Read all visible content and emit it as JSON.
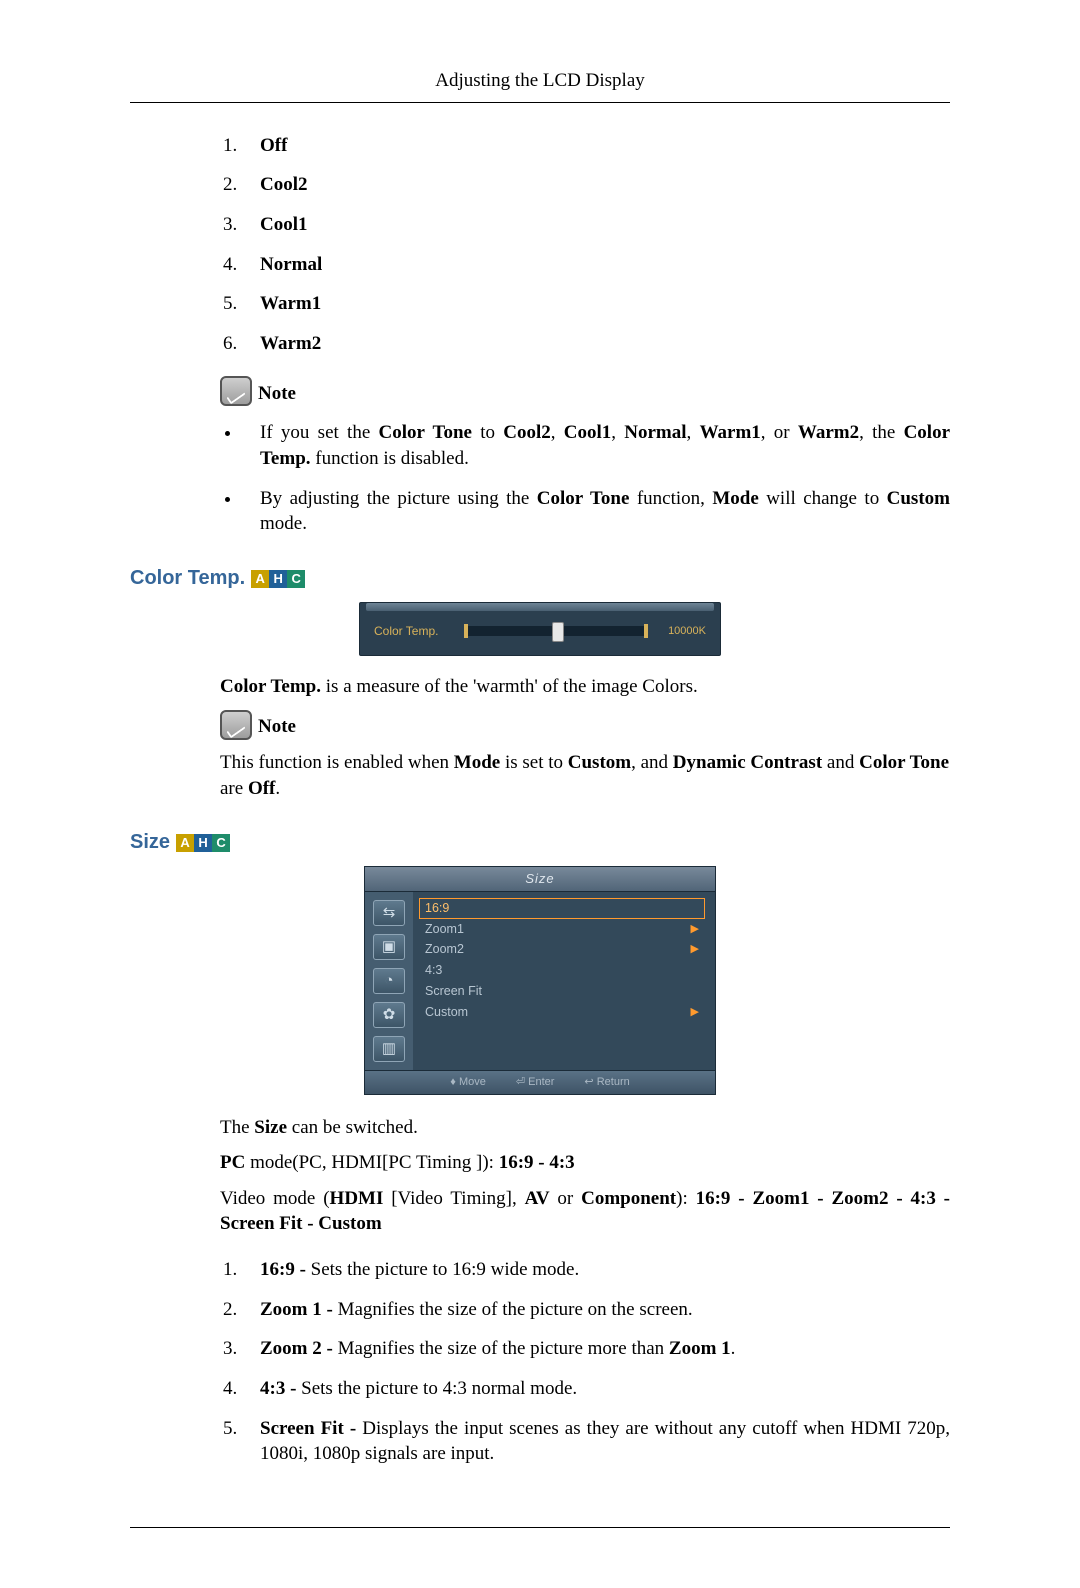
{
  "runningHead": "Adjusting the LCD Display",
  "colorToneOptions": [
    "Off",
    "Cool2",
    "Cool1",
    "Normal",
    "Warm1",
    "Warm2"
  ],
  "noteLabel": "Note",
  "colorToneNotes": {
    "bullet1_pre": "If you set the ",
    "bullet1_b1": "Color Tone",
    "bullet1_mid1": " to ",
    "bullet1_b2": "Cool2",
    "bullet1_c1": ", ",
    "bullet1_b3": "Cool1",
    "bullet1_c2": ", ",
    "bullet1_b4": "Normal",
    "bullet1_c3": ", ",
    "bullet1_b5": "Warm1",
    "bullet1_c4": ", or ",
    "bullet1_b6": "Warm2",
    "bullet1_c5": ", the ",
    "bullet1_b7": "Color Temp.",
    "bullet1_post": " function is disabled.",
    "bullet2_pre": "By adjusting the picture using the ",
    "bullet2_b1": "Color Tone",
    "bullet2_mid": " function, ",
    "bullet2_b2": "Mode",
    "bullet2_mid2": " will change to ",
    "bullet2_b3": "Custom",
    "bullet2_post": " mode."
  },
  "sectionColorTemp": "Color Temp.",
  "badges": {
    "a": "A",
    "h": "H",
    "c": "C"
  },
  "ctPanel": {
    "label": "Color Temp.",
    "value": "10000K"
  },
  "ctDesc": {
    "b1": "Color Temp.",
    "rest": " is a measure of the 'warmth' of the image Colors."
  },
  "ctNote": {
    "pre": "This function is enabled when ",
    "b1": "Mode",
    "mid1": " is set to ",
    "b2": "Custom",
    "mid2": ", and ",
    "b3": "Dynamic Contrast",
    "mid3": " and ",
    "b4": "Color Tone",
    "mid4": " are ",
    "b5": "Off",
    "post": "."
  },
  "sectionSize": "Size",
  "osd": {
    "title": "Size",
    "items": [
      "16:9",
      "Zoom1",
      "Zoom2",
      "4:3",
      "Screen Fit",
      "Custom"
    ],
    "footer": {
      "move": "Move",
      "enter": "Enter",
      "return": "Return"
    }
  },
  "sizeBody1": {
    "pre": "The ",
    "b": "Size",
    "post": " can be switched."
  },
  "sizeBody2": {
    "b1": "PC",
    "t1": " mode(PC, HDMI[PC Timing ]): ",
    "b2": "16:9 - 4:3"
  },
  "sizeBody3": {
    "t1": "Video mode (",
    "b1": "HDMI ",
    "t2": "[Video Timing], ",
    "b2": "AV",
    "t3": " or ",
    "b3": "Component",
    "t4": "): ",
    "b4": "16:9 - Zoom1 - Zoom2 - 4:3 - Screen Fit - Custom"
  },
  "sizeList": [
    {
      "b": "16:9 -",
      "t": " Sets the picture to 16:9 wide mode."
    },
    {
      "b": "Zoom 1 -",
      "t": " Magnifies the size of the picture on the screen."
    },
    {
      "b": "Zoom 2 -",
      "t": " Magnifies the size of the picture more than ",
      "b2": "Zoom 1",
      "t2": "."
    },
    {
      "b": "4:3 -",
      "t": " Sets the picture to 4:3 normal mode."
    },
    {
      "b": "Screen Fit -",
      "t": " Displays the input scenes as they are without any cutoff when HDMI 720p, 1080i, 1080p signals are input."
    }
  ]
}
